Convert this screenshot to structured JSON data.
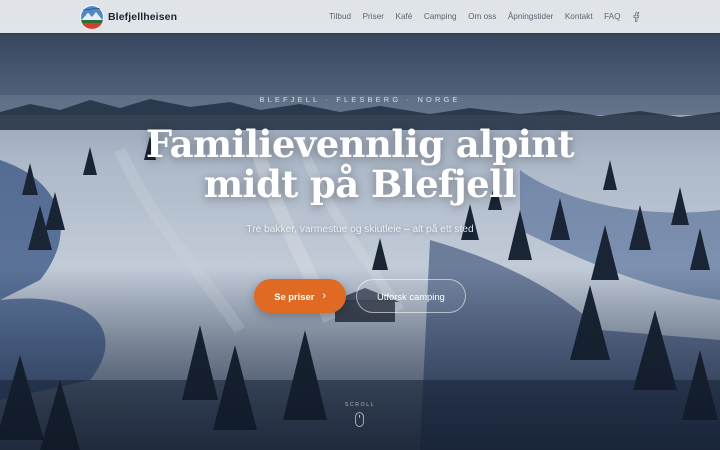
{
  "brand": {
    "name": "Blefjellheisen",
    "logo_icon": "ski-lift-mountain-logo-icon"
  },
  "nav": {
    "items": [
      {
        "label": "Tilbud"
      },
      {
        "label": "Priser"
      },
      {
        "label": "Kafé"
      },
      {
        "label": "Camping"
      },
      {
        "label": "Om oss"
      },
      {
        "label": "Åpningstider"
      },
      {
        "label": "Kontakt"
      },
      {
        "label": "FAQ"
      }
    ],
    "social_icon": "facebook-icon"
  },
  "hero": {
    "eyebrow": "BLEFJELL · FLESBERG · NORGE",
    "title_line1": "Familievennlig alpint",
    "title_line2": "midt på Blefjell",
    "subtitle": "Tre bakker, varmestue og skiutleie – alt på ett sted",
    "primary_cta": "Se priser",
    "primary_cta_icon": "chevron-right-icon",
    "secondary_cta": "Utforsk camping",
    "scroll_label": "SCROLL",
    "scroll_icon": "mouse-icon"
  },
  "colors": {
    "accent": "#e06a24",
    "nav_bg": "#eef1f4",
    "nav_text": "#5b6470",
    "brand_text": "#1c2430"
  }
}
